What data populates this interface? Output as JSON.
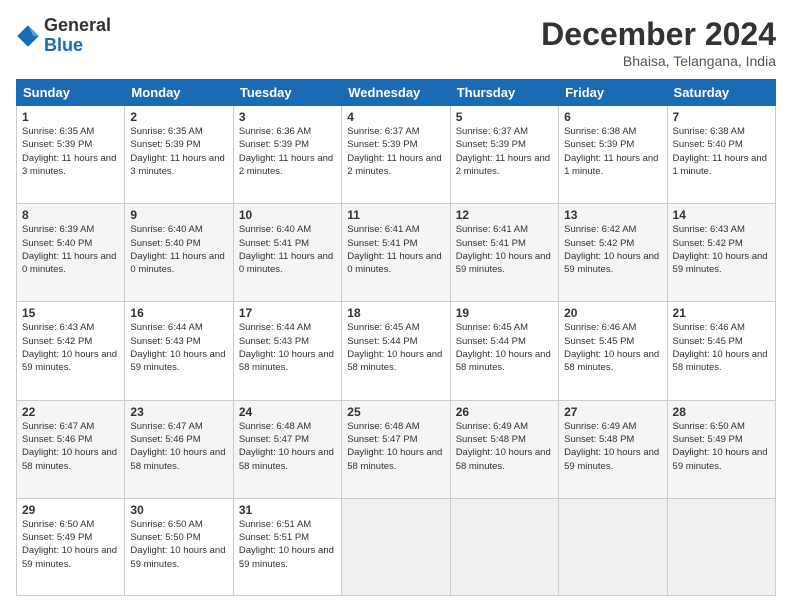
{
  "logo": {
    "general": "General",
    "blue": "Blue"
  },
  "title": "December 2024",
  "location": "Bhaisa, Telangana, India",
  "days_of_week": [
    "Sunday",
    "Monday",
    "Tuesday",
    "Wednesday",
    "Thursday",
    "Friday",
    "Saturday"
  ],
  "weeks": [
    [
      {
        "day": "1",
        "sunrise": "6:35 AM",
        "sunset": "5:39 PM",
        "daylight": "11 hours and 3 minutes."
      },
      {
        "day": "2",
        "sunrise": "6:35 AM",
        "sunset": "5:39 PM",
        "daylight": "11 hours and 3 minutes."
      },
      {
        "day": "3",
        "sunrise": "6:36 AM",
        "sunset": "5:39 PM",
        "daylight": "11 hours and 2 minutes."
      },
      {
        "day": "4",
        "sunrise": "6:37 AM",
        "sunset": "5:39 PM",
        "daylight": "11 hours and 2 minutes."
      },
      {
        "day": "5",
        "sunrise": "6:37 AM",
        "sunset": "5:39 PM",
        "daylight": "11 hours and 2 minutes."
      },
      {
        "day": "6",
        "sunrise": "6:38 AM",
        "sunset": "5:39 PM",
        "daylight": "11 hours and 1 minute."
      },
      {
        "day": "7",
        "sunrise": "6:38 AM",
        "sunset": "5:40 PM",
        "daylight": "11 hours and 1 minute."
      }
    ],
    [
      {
        "day": "8",
        "sunrise": "6:39 AM",
        "sunset": "5:40 PM",
        "daylight": "11 hours and 0 minutes."
      },
      {
        "day": "9",
        "sunrise": "6:40 AM",
        "sunset": "5:40 PM",
        "daylight": "11 hours and 0 minutes."
      },
      {
        "day": "10",
        "sunrise": "6:40 AM",
        "sunset": "5:41 PM",
        "daylight": "11 hours and 0 minutes."
      },
      {
        "day": "11",
        "sunrise": "6:41 AM",
        "sunset": "5:41 PM",
        "daylight": "11 hours and 0 minutes."
      },
      {
        "day": "12",
        "sunrise": "6:41 AM",
        "sunset": "5:41 PM",
        "daylight": "10 hours and 59 minutes."
      },
      {
        "day": "13",
        "sunrise": "6:42 AM",
        "sunset": "5:42 PM",
        "daylight": "10 hours and 59 minutes."
      },
      {
        "day": "14",
        "sunrise": "6:43 AM",
        "sunset": "5:42 PM",
        "daylight": "10 hours and 59 minutes."
      }
    ],
    [
      {
        "day": "15",
        "sunrise": "6:43 AM",
        "sunset": "5:42 PM",
        "daylight": "10 hours and 59 minutes."
      },
      {
        "day": "16",
        "sunrise": "6:44 AM",
        "sunset": "5:43 PM",
        "daylight": "10 hours and 59 minutes."
      },
      {
        "day": "17",
        "sunrise": "6:44 AM",
        "sunset": "5:43 PM",
        "daylight": "10 hours and 58 minutes."
      },
      {
        "day": "18",
        "sunrise": "6:45 AM",
        "sunset": "5:44 PM",
        "daylight": "10 hours and 58 minutes."
      },
      {
        "day": "19",
        "sunrise": "6:45 AM",
        "sunset": "5:44 PM",
        "daylight": "10 hours and 58 minutes."
      },
      {
        "day": "20",
        "sunrise": "6:46 AM",
        "sunset": "5:45 PM",
        "daylight": "10 hours and 58 minutes."
      },
      {
        "day": "21",
        "sunrise": "6:46 AM",
        "sunset": "5:45 PM",
        "daylight": "10 hours and 58 minutes."
      }
    ],
    [
      {
        "day": "22",
        "sunrise": "6:47 AM",
        "sunset": "5:46 PM",
        "daylight": "10 hours and 58 minutes."
      },
      {
        "day": "23",
        "sunrise": "6:47 AM",
        "sunset": "5:46 PM",
        "daylight": "10 hours and 58 minutes."
      },
      {
        "day": "24",
        "sunrise": "6:48 AM",
        "sunset": "5:47 PM",
        "daylight": "10 hours and 58 minutes."
      },
      {
        "day": "25",
        "sunrise": "6:48 AM",
        "sunset": "5:47 PM",
        "daylight": "10 hours and 58 minutes."
      },
      {
        "day": "26",
        "sunrise": "6:49 AM",
        "sunset": "5:48 PM",
        "daylight": "10 hours and 58 minutes."
      },
      {
        "day": "27",
        "sunrise": "6:49 AM",
        "sunset": "5:48 PM",
        "daylight": "10 hours and 59 minutes."
      },
      {
        "day": "28",
        "sunrise": "6:50 AM",
        "sunset": "5:49 PM",
        "daylight": "10 hours and 59 minutes."
      }
    ],
    [
      {
        "day": "29",
        "sunrise": "6:50 AM",
        "sunset": "5:49 PM",
        "daylight": "10 hours and 59 minutes."
      },
      {
        "day": "30",
        "sunrise": "6:50 AM",
        "sunset": "5:50 PM",
        "daylight": "10 hours and 59 minutes."
      },
      {
        "day": "31",
        "sunrise": "6:51 AM",
        "sunset": "5:51 PM",
        "daylight": "10 hours and 59 minutes."
      },
      null,
      null,
      null,
      null
    ]
  ]
}
